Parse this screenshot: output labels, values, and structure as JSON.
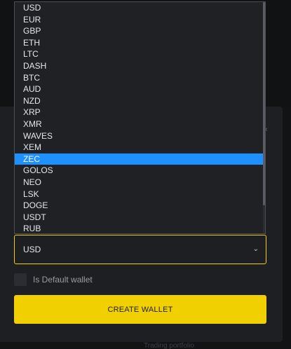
{
  "colors": {
    "accent": "#f0d000",
    "selected": "#1e90ff",
    "panel": "#1d1f23",
    "text": "#e6e7e9",
    "muted": "#9a9ca0"
  },
  "dropdown": {
    "options": [
      "USD",
      "EUR",
      "GBP",
      "ETH",
      "LTC",
      "DASH",
      "BTC",
      "AUD",
      "NZD",
      "XRP",
      "XMR",
      "WAVES",
      "XEM",
      "ZEC",
      "GOLOS",
      "NEO",
      "LSK",
      "DOGE",
      "USDT",
      "RUB"
    ],
    "highlighted": "ZEC"
  },
  "select": {
    "value": "USD",
    "chevron_icon": "chevron-down-icon"
  },
  "default_wallet": {
    "label": "Is Default wallet",
    "checked": false
  },
  "button": {
    "label": "CREATE WALLET"
  },
  "background": {
    "faint_text": "Trading portfolio"
  }
}
